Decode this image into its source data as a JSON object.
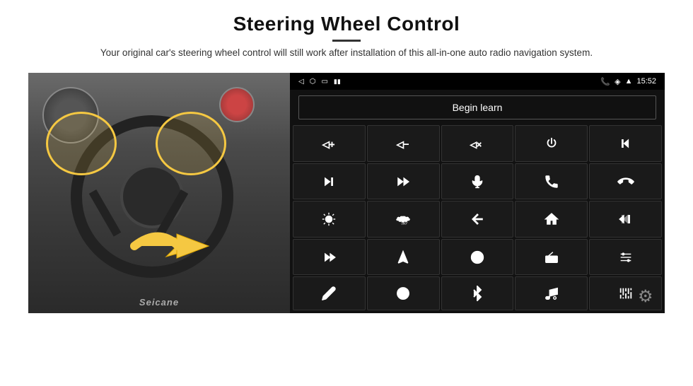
{
  "header": {
    "title": "Steering Wheel Control",
    "divider": true,
    "subtitle": "Your original car's steering wheel control will still work after installation of this all-in-one auto radio navigation system."
  },
  "status_bar": {
    "back_icon": "◁",
    "home_icon": "⬜",
    "recents_icon": "▭",
    "signal_icon": "📶",
    "phone_icon": "📞",
    "wifi_icon": "◈",
    "signal2_icon": "▲",
    "time": "15:52"
  },
  "begin_learn": {
    "label": "Begin learn"
  },
  "controls": [
    {
      "id": "vol-up",
      "icon": "vol-up"
    },
    {
      "id": "vol-down",
      "icon": "vol-down"
    },
    {
      "id": "mute",
      "icon": "mute"
    },
    {
      "id": "power",
      "icon": "power"
    },
    {
      "id": "prev-track",
      "icon": "prev-track"
    },
    {
      "id": "next",
      "icon": "next"
    },
    {
      "id": "ff",
      "icon": "ff"
    },
    {
      "id": "mic",
      "icon": "mic"
    },
    {
      "id": "phone",
      "icon": "phone"
    },
    {
      "id": "hang-up",
      "icon": "hang-up"
    },
    {
      "id": "brightness",
      "icon": "brightness"
    },
    {
      "id": "360",
      "icon": "360"
    },
    {
      "id": "back",
      "icon": "back"
    },
    {
      "id": "home",
      "icon": "home"
    },
    {
      "id": "prev",
      "icon": "prev"
    },
    {
      "id": "skip-fwd",
      "icon": "skip-fwd"
    },
    {
      "id": "nav",
      "icon": "nav"
    },
    {
      "id": "swap",
      "icon": "swap"
    },
    {
      "id": "radio",
      "icon": "radio"
    },
    {
      "id": "settings",
      "icon": "settings"
    },
    {
      "id": "pen",
      "icon": "pen"
    },
    {
      "id": "circle-power",
      "icon": "circle-power"
    },
    {
      "id": "bluetooth",
      "icon": "bluetooth"
    },
    {
      "id": "music",
      "icon": "music"
    },
    {
      "id": "equalizer",
      "icon": "equalizer"
    }
  ],
  "watermark": "Seicane",
  "settings_icon": "⚙"
}
